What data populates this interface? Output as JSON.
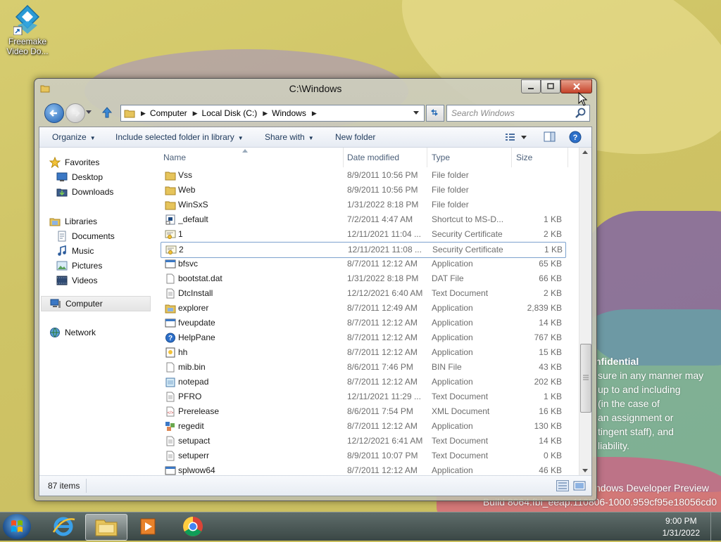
{
  "desktop": {
    "icon_label_line1": "Freemake",
    "icon_label_line2": "Video Do...",
    "watermark": {
      "heading": "nfidential",
      "lines": [
        "sure in any manner may",
        "up to and including",
        "(in the case of",
        "an assignment or",
        "tingent staff), and",
        "liability."
      ],
      "edition": "ndows Developer Preview",
      "build": "Build 8064.fbl_eeap.110806-1000.959cf95e18056cd0"
    }
  },
  "window": {
    "title": "C:\\Windows",
    "address": [
      "Computer",
      "Local Disk (C:)",
      "Windows"
    ],
    "search_placeholder": "Search Windows",
    "toolbar": {
      "organize": "Organize",
      "include": "Include selected folder in library",
      "share": "Share with",
      "new_folder": "New folder"
    },
    "nav": {
      "favorites": "Favorites",
      "desktop": "Desktop",
      "downloads": "Downloads",
      "libraries": "Libraries",
      "documents": "Documents",
      "music": "Music",
      "pictures": "Pictures",
      "videos": "Videos",
      "computer": "Computer",
      "network": "Network"
    },
    "columns": {
      "name": "Name",
      "date": "Date modified",
      "type": "Type",
      "size": "Size"
    },
    "files": [
      {
        "name": "Vss",
        "date": "8/9/2011 10:56 PM",
        "type": "File folder",
        "size": "",
        "icon": "folder"
      },
      {
        "name": "Web",
        "date": "8/9/2011 10:56 PM",
        "type": "File folder",
        "size": "",
        "icon": "folder"
      },
      {
        "name": "WinSxS",
        "date": "1/31/2022 8:18 PM",
        "type": "File folder",
        "size": "",
        "icon": "folder"
      },
      {
        "name": "_default",
        "date": "7/2/2011 4:47 AM",
        "type": "Shortcut to MS-D...",
        "size": "1 KB",
        "icon": "shortcut"
      },
      {
        "name": "1",
        "date": "12/11/2021 11:04 ...",
        "type": "Security Certificate",
        "size": "2 KB",
        "icon": "cert"
      },
      {
        "name": "2",
        "date": "12/11/2021 11:08 ...",
        "type": "Security Certificate",
        "size": "1 KB",
        "icon": "cert"
      },
      {
        "name": "bfsvc",
        "date": "8/7/2011 12:12 AM",
        "type": "Application",
        "size": "65 KB",
        "icon": "app"
      },
      {
        "name": "bootstat.dat",
        "date": "1/31/2022 8:18 PM",
        "type": "DAT File",
        "size": "66 KB",
        "icon": "file"
      },
      {
        "name": "DtcInstall",
        "date": "12/12/2021 6:40 AM",
        "type": "Text Document",
        "size": "2 KB",
        "icon": "text"
      },
      {
        "name": "explorer",
        "date": "8/7/2011 12:49 AM",
        "type": "Application",
        "size": "2,839 KB",
        "icon": "explorer"
      },
      {
        "name": "fveupdate",
        "date": "8/7/2011 12:12 AM",
        "type": "Application",
        "size": "14 KB",
        "icon": "app"
      },
      {
        "name": "HelpPane",
        "date": "8/7/2011 12:12 AM",
        "type": "Application",
        "size": "767 KB",
        "icon": "help"
      },
      {
        "name": "hh",
        "date": "8/7/2011 12:12 AM",
        "type": "Application",
        "size": "15 KB",
        "icon": "hh"
      },
      {
        "name": "mib.bin",
        "date": "8/6/2011 7:46 PM",
        "type": "BIN File",
        "size": "43 KB",
        "icon": "file"
      },
      {
        "name": "notepad",
        "date": "8/7/2011 12:12 AM",
        "type": "Application",
        "size": "202 KB",
        "icon": "notepad"
      },
      {
        "name": "PFRO",
        "date": "12/11/2021 11:29 ...",
        "type": "Text Document",
        "size": "1 KB",
        "icon": "text"
      },
      {
        "name": "Prerelease",
        "date": "8/6/2011 7:54 PM",
        "type": "XML Document",
        "size": "16 KB",
        "icon": "xml"
      },
      {
        "name": "regedit",
        "date": "8/7/2011 12:12 AM",
        "type": "Application",
        "size": "130 KB",
        "icon": "regedit"
      },
      {
        "name": "setupact",
        "date": "12/12/2021 6:41 AM",
        "type": "Text Document",
        "size": "14 KB",
        "icon": "text"
      },
      {
        "name": "setuperr",
        "date": "8/9/2011 10:07 PM",
        "type": "Text Document",
        "size": "0 KB",
        "icon": "text"
      },
      {
        "name": "splwow64",
        "date": "8/7/2011 12:12 AM",
        "type": "Application",
        "size": "46 KB",
        "icon": "app"
      }
    ],
    "selected_index": 5,
    "status": "87 items"
  },
  "taskbar": {
    "time": "9:00 PM",
    "date": "1/31/2022",
    "pinned": [
      "internet-explorer",
      "windows-explorer",
      "media-player",
      "chrome"
    ]
  },
  "colors": {
    "accent": "#1e395b",
    "selection": "#7da2ce",
    "close": "#c6432a"
  }
}
